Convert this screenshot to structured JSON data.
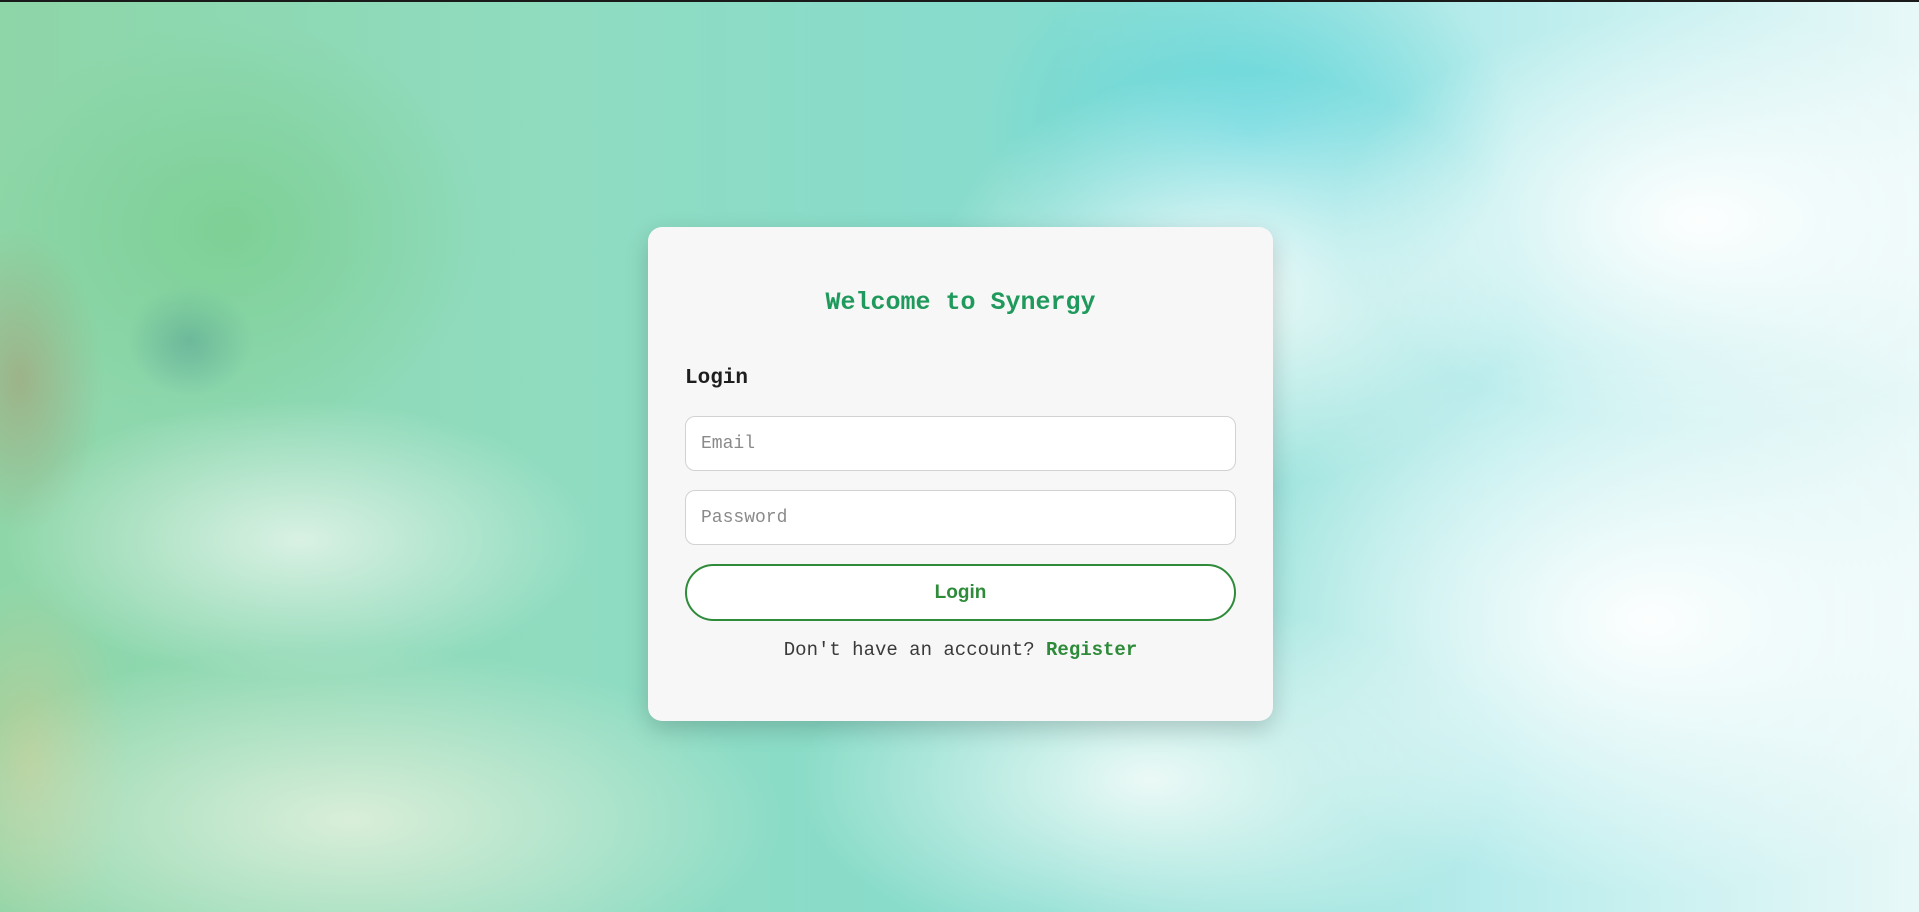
{
  "theme": {
    "title_color": "#1f9a5c",
    "accent_color": "#2e8b3a",
    "card_background": "#f7f7f7"
  },
  "login_card": {
    "title": "Welcome to Synergy",
    "heading": "Login",
    "email_placeholder": "Email",
    "email_value": "",
    "password_placeholder": "Password",
    "password_value": "",
    "submit_label": "Login",
    "register_prompt": "Don't have an account?",
    "register_link": "Register"
  }
}
